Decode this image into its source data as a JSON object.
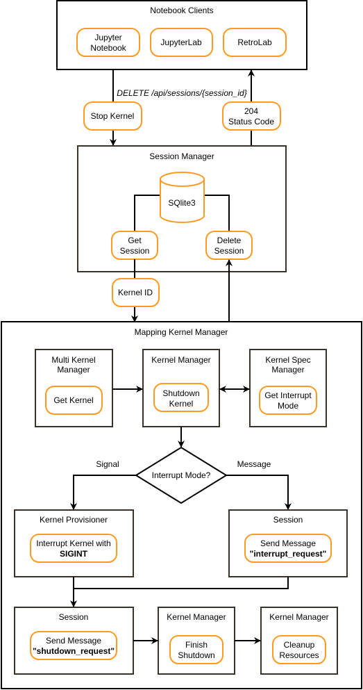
{
  "colors": {
    "accent": "#ff9a1f",
    "border": "#000000",
    "inner_border": "#3a3226"
  },
  "notebook_clients": {
    "title": "Notebook Clients",
    "items": [
      [
        "Jupyter",
        "Notebook"
      ],
      [
        "JupyterLab"
      ],
      [
        "RetroLab"
      ]
    ]
  },
  "request": {
    "label": "DELETE /api/sessions/{session_id}",
    "stop_kernel": "Stop Kernel",
    "status": [
      "204",
      "Status Code"
    ]
  },
  "session_manager": {
    "title": "Session Manager",
    "db": "SQlite3",
    "get_session": [
      "Get",
      "Session"
    ],
    "delete_session": [
      "Delete",
      "Session"
    ]
  },
  "kernel_id": "Kernel ID",
  "mapping_kernel_manager": {
    "title": "Mapping Kernel Manager",
    "multi_kernel_manager": {
      "title": [
        "Multi Kernel",
        "Manager"
      ],
      "action": "Get Kernel"
    },
    "kernel_manager": {
      "title": "Kernel Manager",
      "action": [
        "Shutdown",
        "Kernel"
      ]
    },
    "kernel_spec_manager": {
      "title": [
        "Kernel Spec",
        "Manager"
      ],
      "action": [
        "Get Interrupt",
        "Mode"
      ]
    },
    "decision": {
      "label": "Interrupt Mode?",
      "left": "Signal",
      "right": "Message"
    },
    "kernel_provisioner": {
      "title": "Kernel Provisioner",
      "action": [
        "Interrupt Kernel with",
        "SIGINT"
      ]
    },
    "session_interrupt": {
      "title": "Session",
      "action": [
        "Send Message",
        "\"interrupt_request\""
      ]
    },
    "session_shutdown": {
      "title": "Session",
      "action": [
        "Send Message",
        "\"shutdown_request\""
      ]
    },
    "kernel_manager_finish": {
      "title": "Kernel Manager",
      "action": [
        "Finish",
        "Shutdown"
      ]
    },
    "kernel_manager_cleanup": {
      "title": "Kernel Manager",
      "action": [
        "Cleanup",
        "Resources"
      ]
    }
  }
}
